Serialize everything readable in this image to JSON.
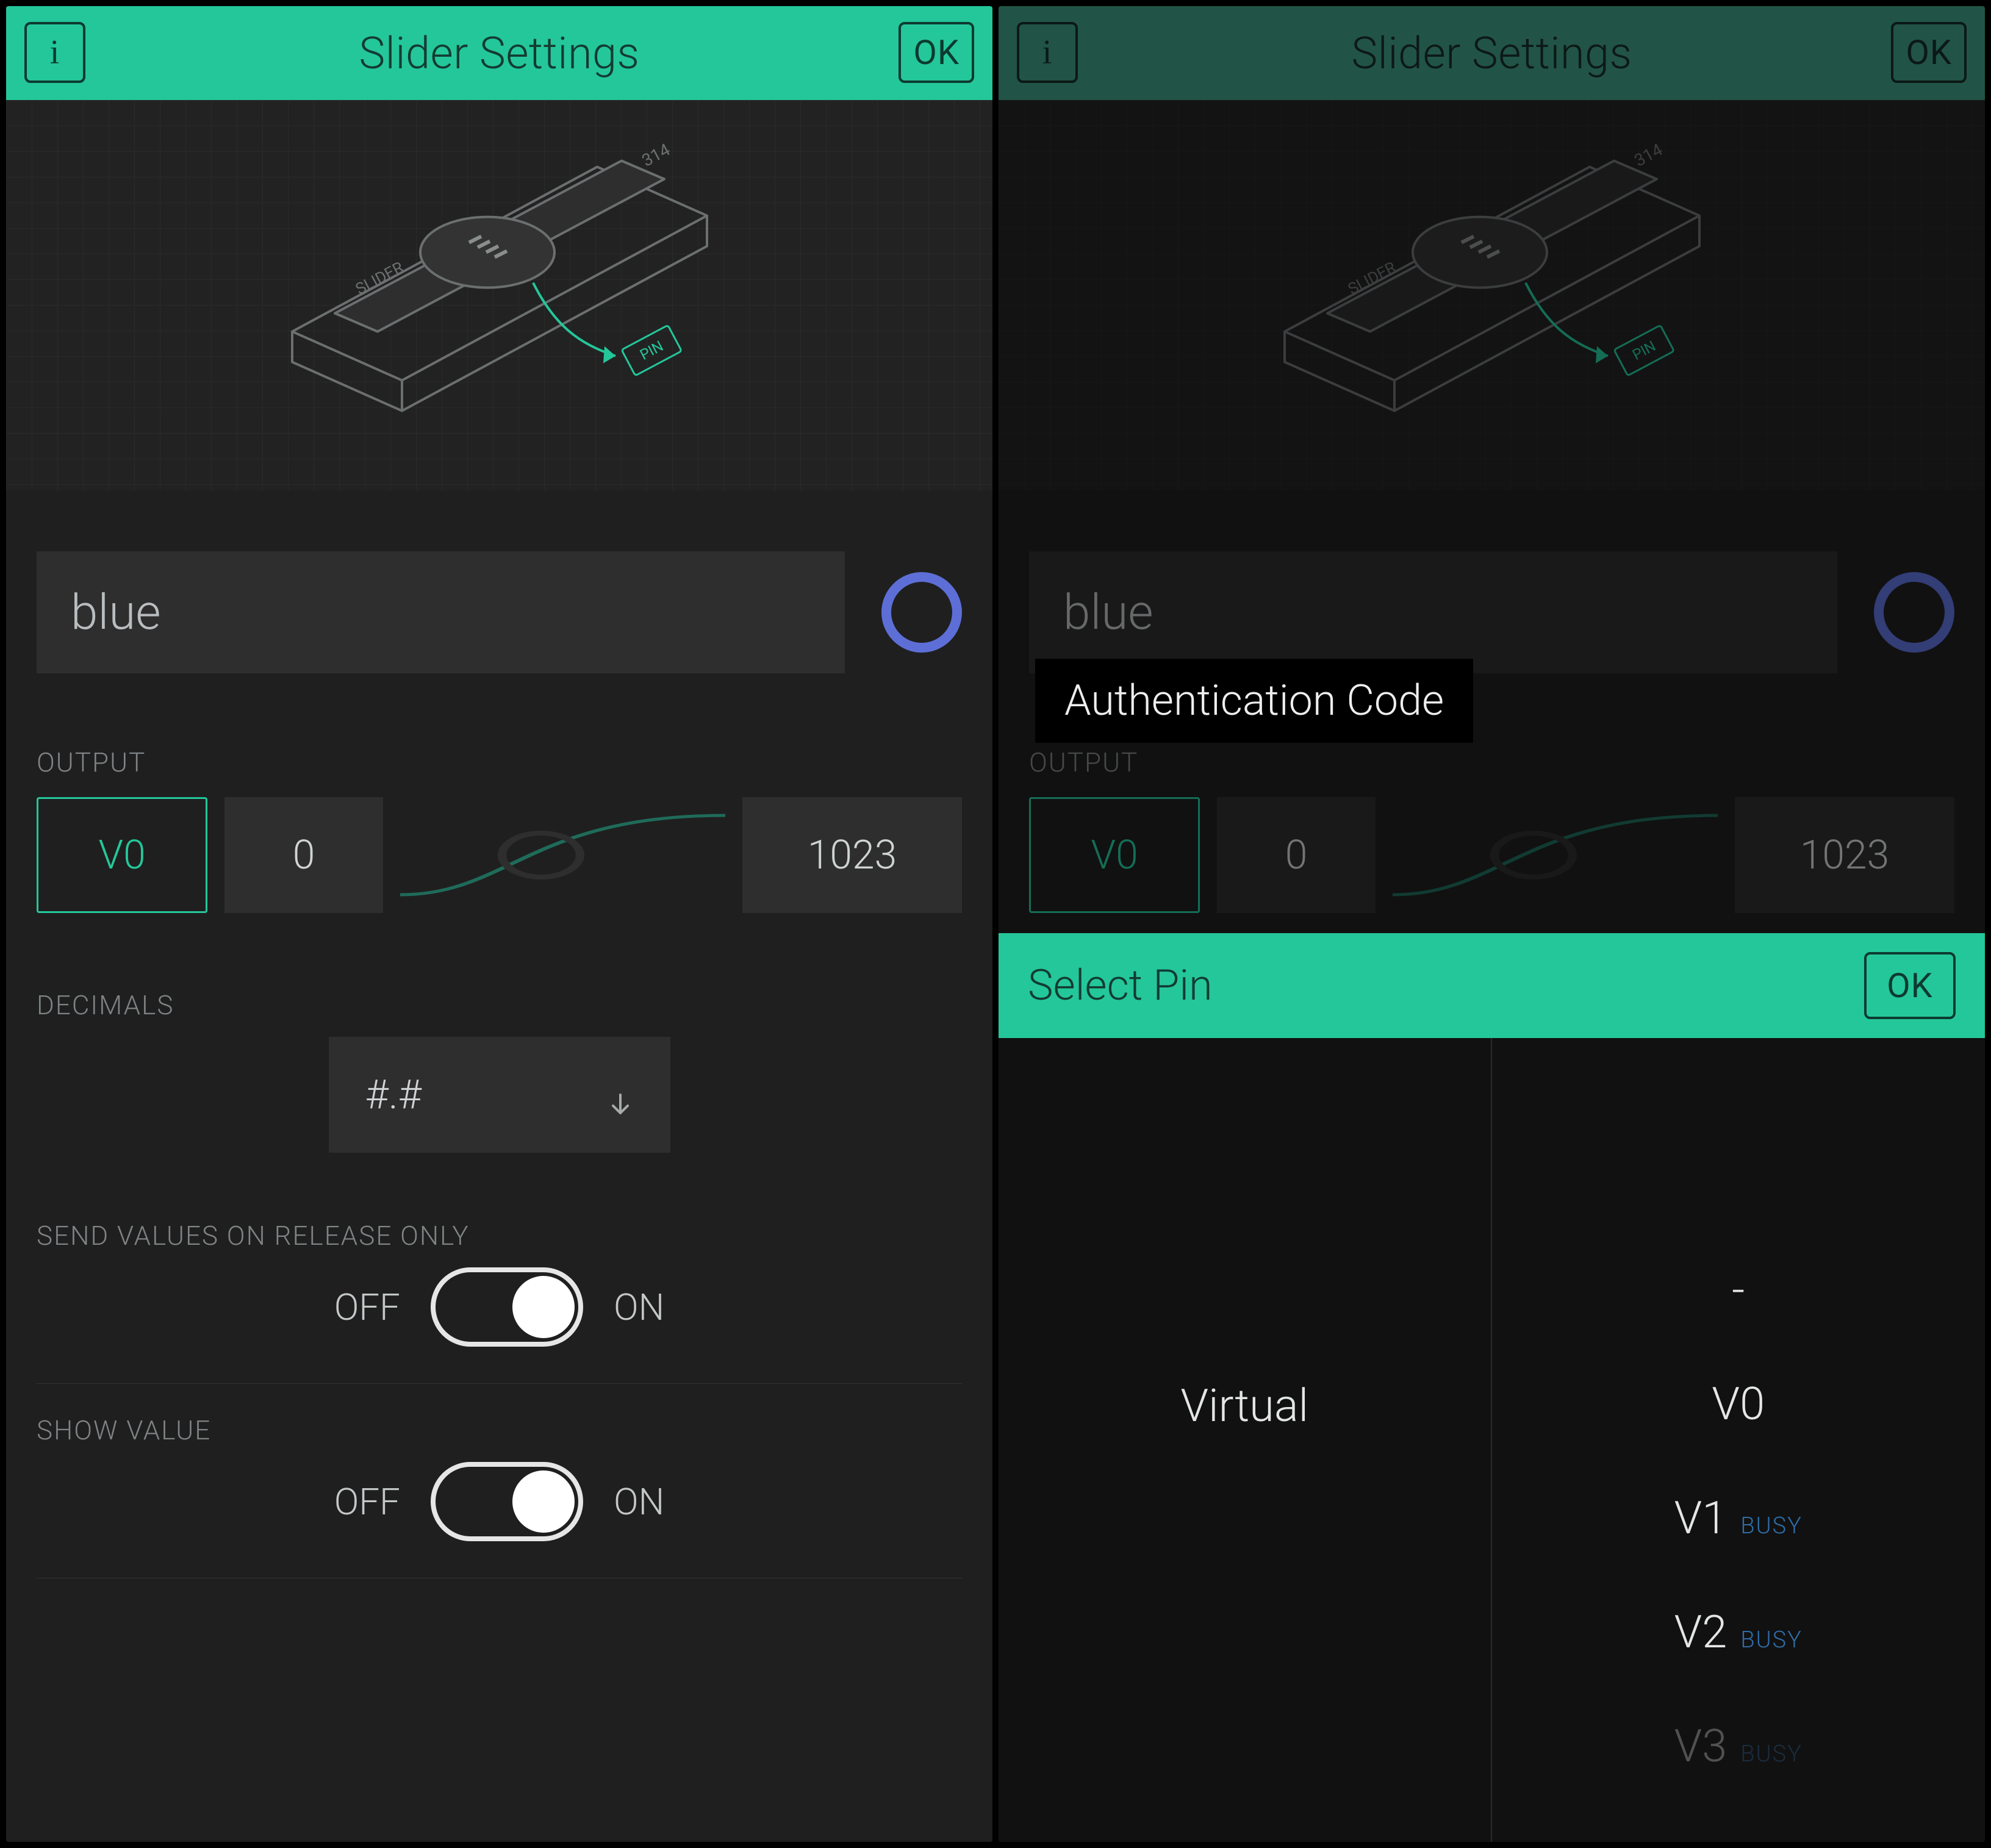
{
  "header": {
    "title": "Slider Settings",
    "info_label": "i",
    "ok_label": "OK"
  },
  "illustration": {
    "side_label": "SLIDER",
    "top_number": "314",
    "pin_tag": "PIN"
  },
  "name": {
    "value": "blue",
    "color_hex": "#5d6fd6"
  },
  "output": {
    "section_label": "OUTPUT",
    "pin": "V0",
    "min": "0",
    "max": "1023"
  },
  "decimals": {
    "section_label": "DECIMALS",
    "value": "#.#"
  },
  "send_on_release": {
    "section_label": "SEND VALUES ON RELEASE ONLY",
    "off_label": "OFF",
    "on_label": "ON",
    "state": "on"
  },
  "show_value": {
    "section_label": "SHOW VALUE",
    "off_label": "OFF",
    "on_label": "ON",
    "state": "on"
  },
  "auth_tooltip": "Authentication Code",
  "select_pin": {
    "title": "Select Pin",
    "ok_label": "OK",
    "category": "Virtual",
    "busy_label": "BUSY",
    "options": [
      {
        "label": "-",
        "busy": false
      },
      {
        "label": "V0",
        "busy": false
      },
      {
        "label": "V1",
        "busy": true
      },
      {
        "label": "V2",
        "busy": true
      },
      {
        "label": "V3",
        "busy": true
      }
    ]
  }
}
